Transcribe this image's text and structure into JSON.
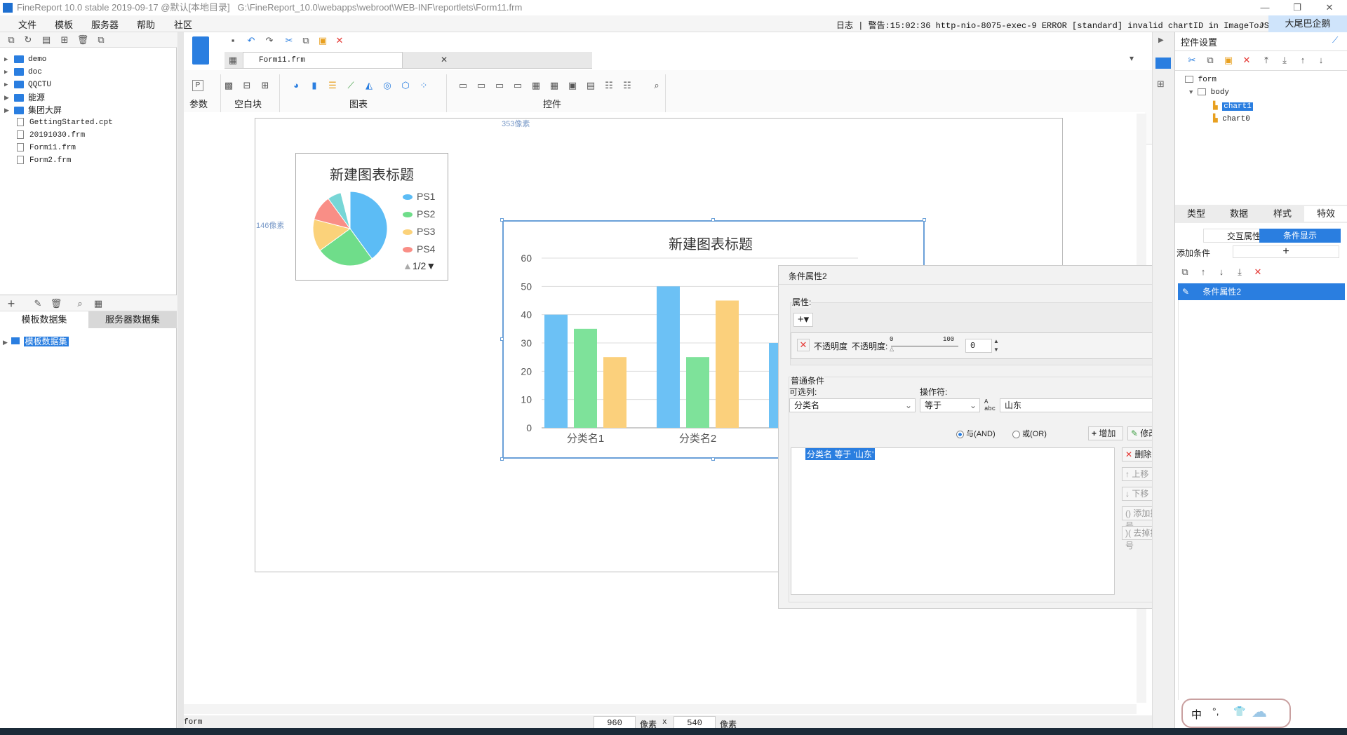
{
  "titlebar": {
    "app": "FineReport 10.0 stable 2019-09-17 @默认[本地目录]",
    "path": "G:\\FineReport_10.0\\webapps\\webroot\\WEB-INF\\reportlets\\Form11.frm",
    "minimize": "—",
    "restore": "❐",
    "close": "✕"
  },
  "menu": [
    "文件",
    "模板",
    "服务器",
    "帮助",
    "社区"
  ],
  "log_text": "日志 | 警告:15:02:36 http-nio-8075-exec-9 ERROR [standard] invalid chartID in ImageToJSONHelper",
  "enterprise": "大尾巴企鹅",
  "file_tree": [
    {
      "type": "folder",
      "name": "demo"
    },
    {
      "type": "folder",
      "name": "doc"
    },
    {
      "type": "folder",
      "name": "QQCTU"
    },
    {
      "type": "folder",
      "name": "能源"
    },
    {
      "type": "folder",
      "name": "集团大屏"
    },
    {
      "type": "file",
      "name": "GettingStarted.cpt"
    },
    {
      "type": "file",
      "name": "20191030.frm"
    },
    {
      "type": "file",
      "name": "Form11.frm"
    },
    {
      "type": "file",
      "name": "Form2.frm"
    }
  ],
  "dataset_tabs": [
    "模板数据集",
    "服务器数据集"
  ],
  "dataset_item": "模板数据集",
  "editor_tab": "Form11.frm",
  "toolbar_groups": {
    "param": "参数",
    "blank": "空白块",
    "chart": "图表",
    "widget": "控件"
  },
  "hints": {
    "width": "353像素",
    "height": "146像素"
  },
  "pie_chart": {
    "title": "新建图表标题",
    "legend": [
      "PS1",
      "PS2",
      "PS3",
      "PS4"
    ],
    "pager": "1/2",
    "colors": [
      "#5cbcf5",
      "#6fdd8a",
      "#fbd27a",
      "#f98e86",
      "#77d6d6"
    ]
  },
  "chart_data": {
    "type": "bar",
    "title": "新建图表标题",
    "categories": [
      "分类名1",
      "分类名2"
    ],
    "series": [
      {
        "values": [
          40,
          50
        ],
        "color": "#6cc1f5"
      },
      {
        "values": [
          35,
          25
        ],
        "color": "#7ee29a"
      },
      {
        "values": [
          25,
          45
        ],
        "color": "#fbd07c"
      }
    ],
    "yticks": [
      "60",
      "50",
      "40",
      "30",
      "20",
      "10",
      "0"
    ],
    "ylim": [
      0,
      60
    ],
    "grid": true
  },
  "dialog": {
    "title": "条件属性2",
    "attr_label": "属性:",
    "opacity_label1": "不透明度",
    "opacity_label2": "不透明度:",
    "slider_min": "0",
    "slider_max": "100",
    "opacity_value": "0",
    "common_cond": "普通条件",
    "selectable_col": "可选列:",
    "operator": "操作符:",
    "col_value": "分类名",
    "op_value": "等于",
    "cond_value": "山东",
    "and_label": "与(AND)",
    "or_label": "或(OR)",
    "add_btn": "增加",
    "modify_btn": "修改",
    "condition_item": "分类名 等于 '山东'",
    "delete_btn": "删除",
    "up_btn": "上移",
    "down_btn": "下移",
    "add_bracket": "添加括号",
    "remove_bracket": "去掉括号"
  },
  "right_panel": {
    "title": "控件设置",
    "tree": {
      "root": "form",
      "body": "body",
      "items": [
        "chart1",
        "chart0"
      ]
    },
    "tabs": [
      "类型",
      "数据",
      "样式",
      "特效"
    ],
    "subtabs": [
      "交互属性",
      "条件显示"
    ],
    "add_condition": "添加条件",
    "condition_item": "条件属性2"
  },
  "status": {
    "form": "form",
    "width": "960",
    "unit1": "像素",
    "x": "x",
    "height": "540",
    "unit2": "像素"
  },
  "ime": {
    "lang": "中",
    "punct": "°,"
  }
}
